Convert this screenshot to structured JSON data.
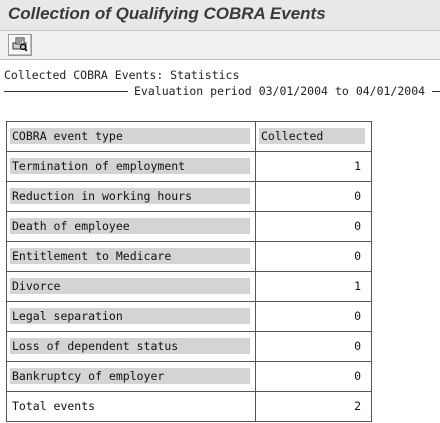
{
  "window": {
    "title": "Collection of Qualifying COBRA Events"
  },
  "toolbar": {
    "icons": [
      "print-preview-icon"
    ]
  },
  "report": {
    "heading": "Collected COBRA Events: Statistics",
    "period_label": "Evaluation period",
    "period_from": "03/01/2004",
    "period_to_word": "to",
    "period_to": "04/01/2004"
  },
  "table": {
    "headers": {
      "type": "COBRA event type",
      "collected": "Collected"
    },
    "rows": [
      {
        "type": "Termination of employment",
        "collected": "1"
      },
      {
        "type": "Reduction in working hours",
        "collected": "0"
      },
      {
        "type": "Death of employee",
        "collected": "0"
      },
      {
        "type": "Entitlement to Medicare",
        "collected": "0"
      },
      {
        "type": "Divorce",
        "collected": "1"
      },
      {
        "type": "Legal separation",
        "collected": "0"
      },
      {
        "type": "Loss of dependent status",
        "collected": "0"
      },
      {
        "type": "Bankruptcy of employer",
        "collected": "0"
      }
    ],
    "total": {
      "type": "Total events",
      "collected": "2"
    }
  },
  "colors": {
    "label_background": "#d4d4d4",
    "title_text": "#3a3a3a"
  }
}
